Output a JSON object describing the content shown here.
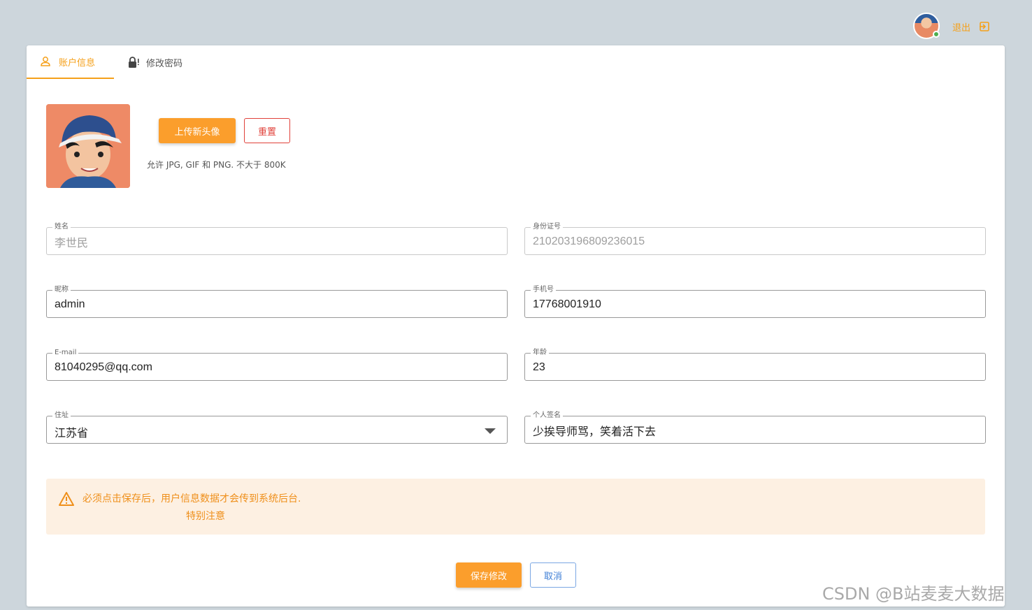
{
  "header": {
    "logout_label": "退出",
    "accent_color": "#f5a01a"
  },
  "tabs": [
    {
      "label": "账户信息",
      "icon": "user-icon",
      "active": true
    },
    {
      "label": "修改密码",
      "icon": "lock-icon",
      "active": false
    }
  ],
  "avatar_section": {
    "upload_label": "上传新头像",
    "reset_label": "重置",
    "hint": "允许 JPG, GIF 和 PNG. 不大于 800K"
  },
  "form": {
    "name": {
      "label": "姓名",
      "value": "李世民",
      "disabled": true
    },
    "id_number": {
      "label": "身份证号",
      "value": "210203196809236015",
      "disabled": true
    },
    "nickname": {
      "label": "昵称",
      "value": "admin"
    },
    "phone": {
      "label": "手机号",
      "value": "17768001910"
    },
    "email": {
      "label": "E-mail",
      "value": "81040295@qq.com"
    },
    "age": {
      "label": "年龄",
      "value": "23"
    },
    "address": {
      "label": "住址",
      "value": "江苏省"
    },
    "signature": {
      "label": "个人签名",
      "value": "少挨导师骂，笑着活下去"
    }
  },
  "alert": {
    "line1": "必须点击保存后，用户信息数据才会传到系统后台.",
    "line2": "特别注意",
    "color": "#ef8f1a"
  },
  "actions": {
    "save_label": "保存修改",
    "cancel_label": "取消"
  },
  "credit": "CSDN @B站麦麦大数据"
}
